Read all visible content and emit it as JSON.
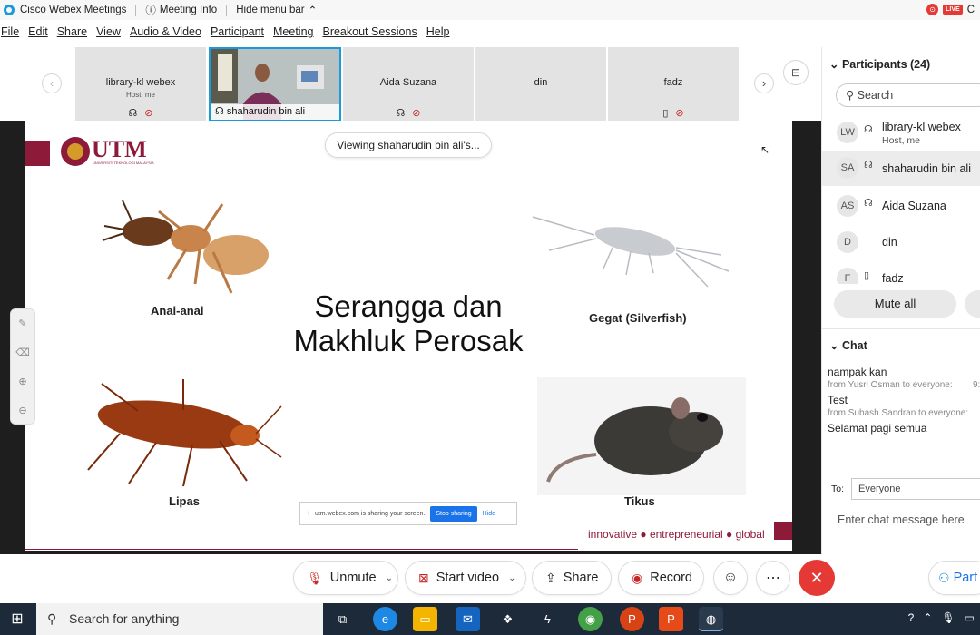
{
  "titlebar": {
    "app_title": "Cisco Webex Meetings",
    "meeting_info": "Meeting Info",
    "hide_menu_bar": "Hide menu bar",
    "live": "LIVE",
    "rec_indicator": "⊙",
    "overflow": "C"
  },
  "menubar": [
    "File",
    "Edit",
    "Share",
    "View",
    "Audio & Video",
    "Participant",
    "Meeting",
    "Breakout Sessions",
    "Help"
  ],
  "video_strip": {
    "tiles": [
      {
        "name": "library-kl webex",
        "sub": "Host, me"
      },
      {
        "name": "shaharudin bin ali"
      },
      {
        "name": "Aida Suzana"
      },
      {
        "name": "din"
      },
      {
        "name": "fadz"
      }
    ]
  },
  "share": {
    "viewing_label": "Viewing shaharudin bin ali's...",
    "logo_text": "UTM",
    "logo_sub": "UNIVERSITI TEKNOLOGI MALAYSIA",
    "slide_title": "Serangga dan Makhluk Perosak",
    "captions": [
      "Anai-anai",
      "Gegat (Silverfish)",
      "Lipas",
      "Tikus"
    ],
    "sharing_notice": "utm.webex.com is sharing your screen.",
    "stop_sharing": "Stop sharing",
    "hide": "Hide",
    "footer": "innovative ● entrepreneurial ● global"
  },
  "controls": {
    "unmute": "Unmute",
    "start_video": "Start video",
    "share": "Share",
    "record": "Record",
    "participants_btn": "Part"
  },
  "participants": {
    "header": "Participants (24)",
    "search_placeholder": "Search",
    "list": [
      {
        "initials": "LW",
        "name": "library-kl webex",
        "sub": "Host, me"
      },
      {
        "initials": "SA",
        "name": "shaharudin bin ali"
      },
      {
        "initials": "AS",
        "name": "Aida Suzana"
      },
      {
        "initials": "D",
        "name": "din"
      },
      {
        "initials": "F",
        "name": "fadz"
      }
    ],
    "mute_all": "Mute all"
  },
  "chat": {
    "header": "Chat",
    "messages": [
      {
        "text": "nampak kan",
        "from": "from Yusri Osman to everyone:",
        "time": "9:"
      },
      {
        "text": "Test",
        "from": "from Subash Sandran to everyone:"
      },
      {
        "text": "Selamat pagi semua"
      }
    ],
    "to_label": "To:",
    "to_value": "Everyone",
    "input_placeholder": "Enter chat message here"
  },
  "taskbar": {
    "search_placeholder": "Search for anything"
  },
  "colors": {
    "accent": "#1a9ad6",
    "brand_maroon": "#8e1a3a",
    "leave_red": "#e53935",
    "taskbar": "#1c2a3a"
  }
}
